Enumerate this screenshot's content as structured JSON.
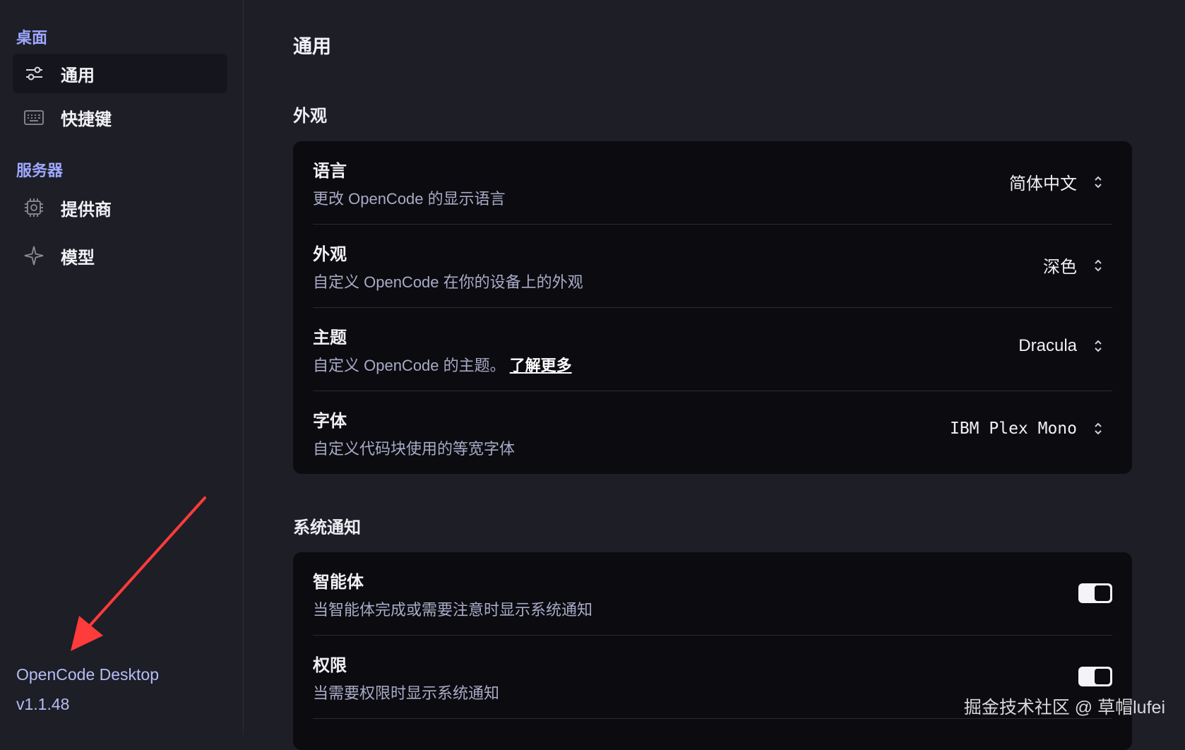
{
  "sidebar": {
    "section_desktop": "桌面",
    "section_server": "服务器",
    "items": [
      {
        "label": "通用",
        "icon": "sliders-icon"
      },
      {
        "label": "快捷键",
        "icon": "keyboard-icon"
      },
      {
        "label": "提供商",
        "icon": "chip-icon"
      },
      {
        "label": "模型",
        "icon": "sparkle-icon"
      }
    ],
    "app_name": "OpenCode Desktop",
    "version": "v1.1.48"
  },
  "main": {
    "page_title": "通用",
    "appearance_group": {
      "title": "外观",
      "rows": [
        {
          "title": "语言",
          "desc": "更改 OpenCode 的显示语言",
          "value": "简体中文"
        },
        {
          "title": "外观",
          "desc": "自定义 OpenCode 在你的设备上的外观",
          "value": "深色"
        },
        {
          "title": "主题",
          "desc": "自定义 OpenCode 的主题。",
          "link": "了解更多",
          "value": "Dracula"
        },
        {
          "title": "字体",
          "desc": "自定义代码块使用的等宽字体",
          "value": "IBM Plex Mono"
        }
      ]
    },
    "notify_group": {
      "title": "系统通知",
      "rows": [
        {
          "title": "智能体",
          "desc": "当智能体完成或需要注意时显示系统通知",
          "enabled": true
        },
        {
          "title": "权限",
          "desc": "当需要权限时显示系统通知",
          "enabled": true
        }
      ]
    }
  },
  "watermark": "掘金技术社区 @ 草帽lufei",
  "colors": {
    "accent": "#9ea8ff",
    "annotation_arrow": "#ff3b3b"
  }
}
